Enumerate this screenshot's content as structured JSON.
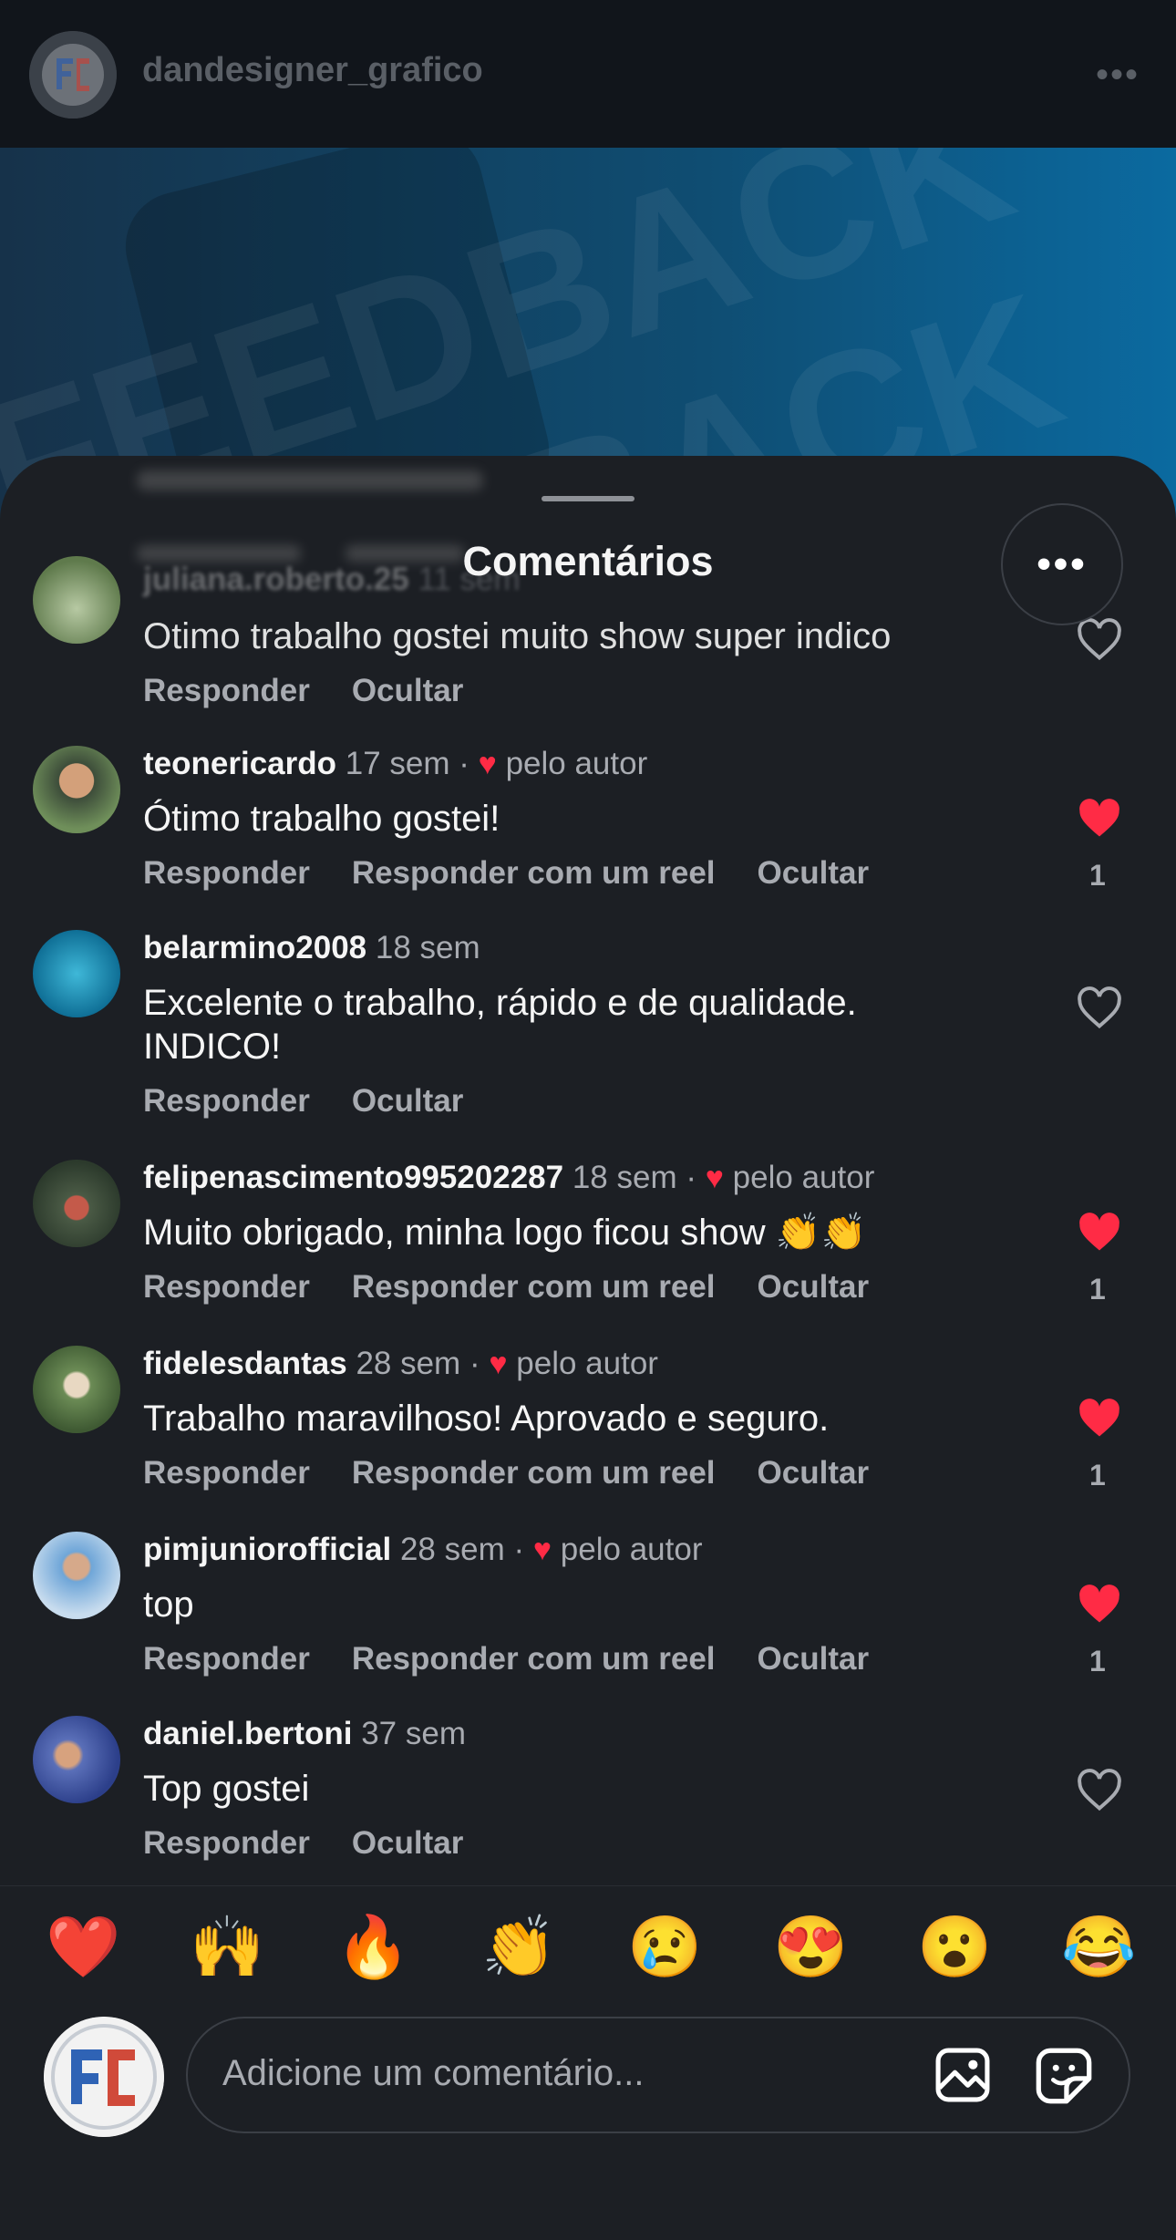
{
  "header": {
    "username": "dandesigner_grafico",
    "more": "•••"
  },
  "post": {
    "watermark_1": "FEEDBACK",
    "watermark_2": "BACK"
  },
  "sheet": {
    "title": "Comentários",
    "more": "•••"
  },
  "labels": {
    "reply": "Responder",
    "reply_reel": "Responder com um reel",
    "hide": "Ocultar",
    "by_author": "pelo autor",
    "dot": "·"
  },
  "comments": [
    {
      "user": "juliana.roberto.25",
      "time": "11 sem",
      "text": "Otimo trabalho gostei muito show super indico",
      "liked_by_author": false,
      "liked": false
    },
    {
      "user": "teonericardo",
      "time": "17 sem",
      "text": "Ótimo trabalho gostei!",
      "liked_by_author": true,
      "liked": true,
      "likes": "1"
    },
    {
      "user": "belarmino2008",
      "time": "18 sem",
      "text": "Excelente o trabalho, rápido e de qualidade. INDICO!",
      "liked_by_author": false,
      "liked": false
    },
    {
      "user": "felipenascimento995202287",
      "time": "18 sem",
      "text": "Muito obrigado, minha logo ficou show 👏👏",
      "liked_by_author": true,
      "liked": true,
      "likes": "1"
    },
    {
      "user": "fidelesdantas",
      "time": "28 sem",
      "text": "Trabalho maravilhoso! Aprovado e seguro.",
      "liked_by_author": true,
      "liked": true,
      "likes": "1"
    },
    {
      "user": "pimjuniorofficial",
      "time": "28 sem",
      "text": "top",
      "liked_by_author": true,
      "liked": true,
      "likes": "1"
    },
    {
      "user": "daniel.bertoni",
      "time": "37 sem",
      "text": "Top gostei",
      "liked_by_author": false,
      "liked": false
    }
  ],
  "emojis": [
    "❤️",
    "🙌",
    "🔥",
    "👏",
    "😢",
    "😍",
    "😮",
    "😂"
  ],
  "composer": {
    "placeholder": "Adicione um comentário..."
  },
  "colors": {
    "heart": "#ff2b45",
    "sheet": "#1c1f24",
    "muted": "#a8abb1"
  }
}
